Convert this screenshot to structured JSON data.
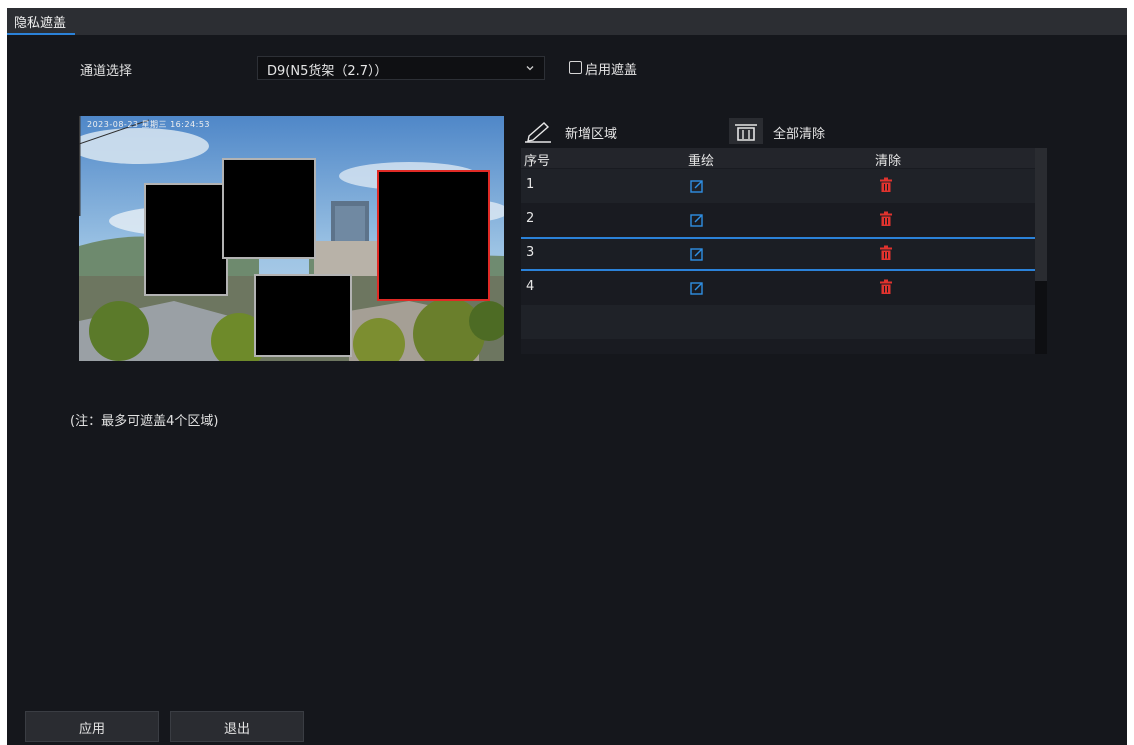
{
  "tab": {
    "label": "隐私遮盖"
  },
  "channel": {
    "label": "通道选择",
    "value": "D9(N5货架（2.7））"
  },
  "enable": {
    "label": "启用遮盖",
    "checked": false
  },
  "preview": {
    "osd": "2023-08-23 星期三 16:24:53"
  },
  "toolbar": {
    "add_label": "新增区域",
    "clear_all_label": "全部清除"
  },
  "table": {
    "headers": {
      "no": "序号",
      "redraw": "重绘",
      "delete": "清除"
    },
    "rows": [
      {
        "no": "1"
      },
      {
        "no": "2"
      },
      {
        "no": "3",
        "selected": true
      },
      {
        "no": "4"
      }
    ]
  },
  "note": "(注：最多可遮盖4个区域)",
  "footer": {
    "apply_label": "应用",
    "exit_label": "退出"
  },
  "colors": {
    "accent": "#2b82d9",
    "delete": "#e0332e",
    "selected_mask": "#e02a25"
  },
  "icons": [
    "chevron-down-icon",
    "pencil-icon",
    "trash-bin-icon",
    "edit-icon",
    "delete-icon"
  ]
}
